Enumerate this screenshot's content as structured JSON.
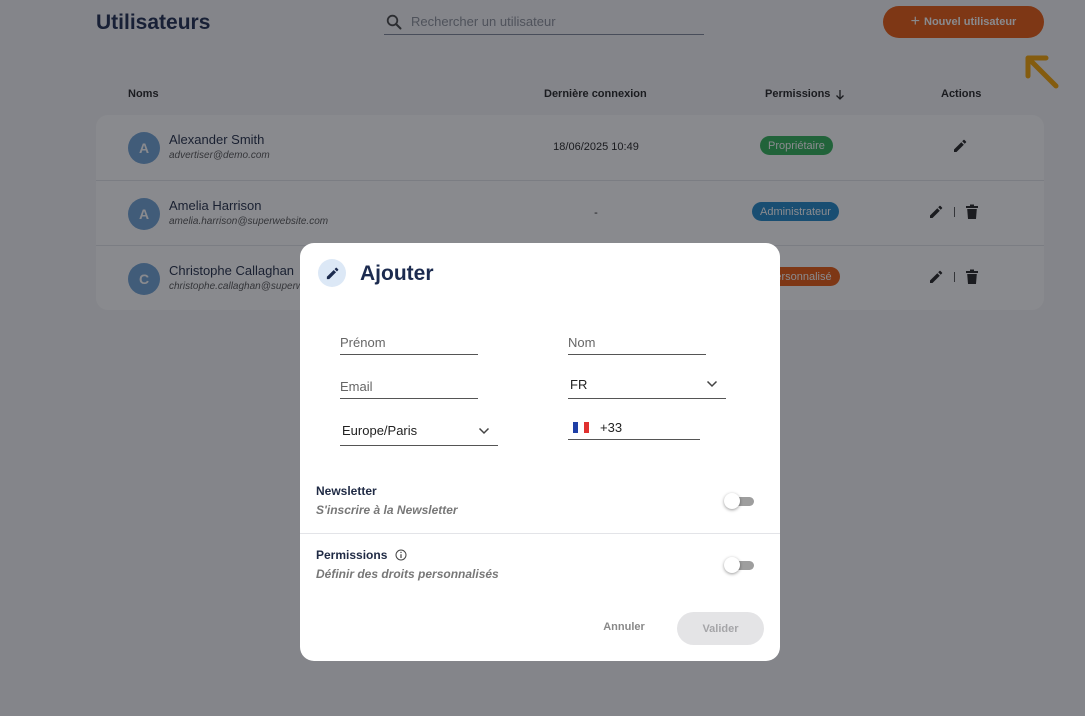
{
  "header": {
    "title": "Utilisateurs",
    "search_placeholder": "Rechercher un utilisateur",
    "new_user_label": "Nouvel utilisateur",
    "new_user_color": "#e8590c"
  },
  "table": {
    "columns": {
      "names": "Noms",
      "last_login": "Dernière connexion",
      "permissions": "Permissions",
      "actions": "Actions"
    },
    "rows": [
      {
        "initial": "A",
        "name": "Alexander Smith",
        "email": "advertiser@demo.com",
        "last_login": "18/06/2025 10:49",
        "permission": "Propriétaire",
        "permission_color": "#2fb157",
        "can_delete": false
      },
      {
        "initial": "A",
        "name": "Amelia Harrison",
        "email": "amelia.harrison@superwebsite.com",
        "last_login": "-",
        "permission": "Administrateur",
        "permission_color": "#1e86c6",
        "can_delete": true
      },
      {
        "initial": "C",
        "name": "Christophe Callaghan",
        "email": "christophe.callaghan@superwebsite.com",
        "last_login": "",
        "permission": "Personnalisé",
        "permission_color": "#e8590c",
        "can_delete": true
      }
    ]
  },
  "modal": {
    "title": "Ajouter",
    "fields": {
      "first_name_placeholder": "Prénom",
      "last_name_placeholder": "Nom",
      "email_placeholder": "Email",
      "country_value": "FR",
      "timezone_value": "Europe/Paris",
      "phone_prefix": "+33"
    },
    "newsletter": {
      "title": "Newsletter",
      "subtitle": "S'inscrire à la Newsletter",
      "enabled": false
    },
    "permissions": {
      "title": "Permissions",
      "subtitle": "Définir des droits personnalisés",
      "enabled": false
    },
    "cancel_label": "Annuler",
    "submit_label": "Valider"
  }
}
